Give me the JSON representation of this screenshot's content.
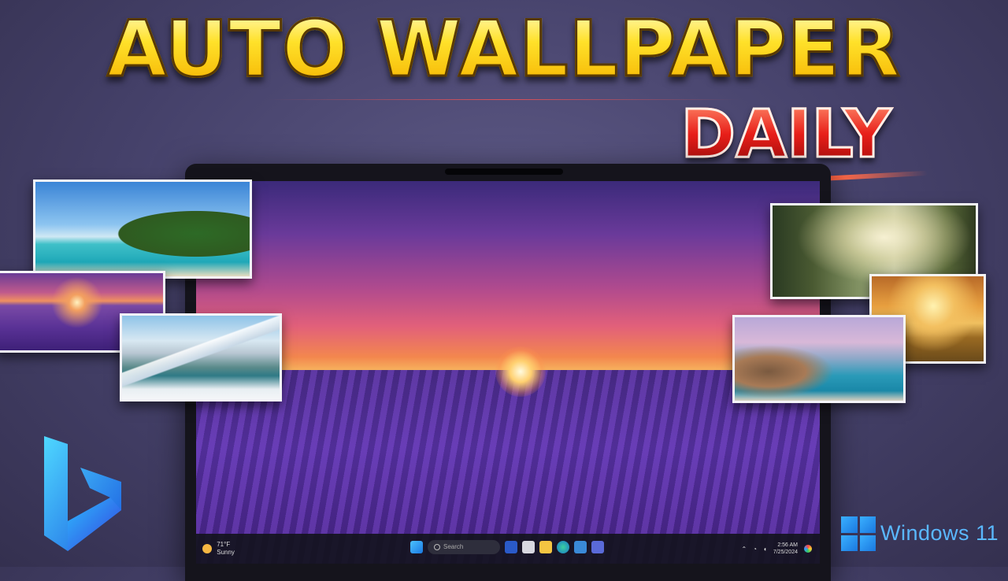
{
  "headline": {
    "main": "AUTO WALLPAPER",
    "sub": "DAILY"
  },
  "taskbar": {
    "weather_temp": "71°F",
    "weather_desc": "Sunny",
    "search_placeholder": "Search",
    "clock_time": "2:56 AM",
    "clock_date": "7/25/2024"
  },
  "branding": {
    "windows_label": "Windows 11",
    "windows_color": "#3ab0ff",
    "bing_icon": "bing-logo"
  },
  "thumbnails": [
    {
      "subject": "tropical-beach"
    },
    {
      "subject": "lavender-sunset"
    },
    {
      "subject": "snowy-mountain-lake"
    },
    {
      "subject": "misty-forest"
    },
    {
      "subject": "savanna-giraffe"
    },
    {
      "subject": "coastal-village"
    }
  ],
  "colors": {
    "title_yellow": "#ffe12a",
    "title_red": "#e8201a",
    "background": "#45416a"
  }
}
